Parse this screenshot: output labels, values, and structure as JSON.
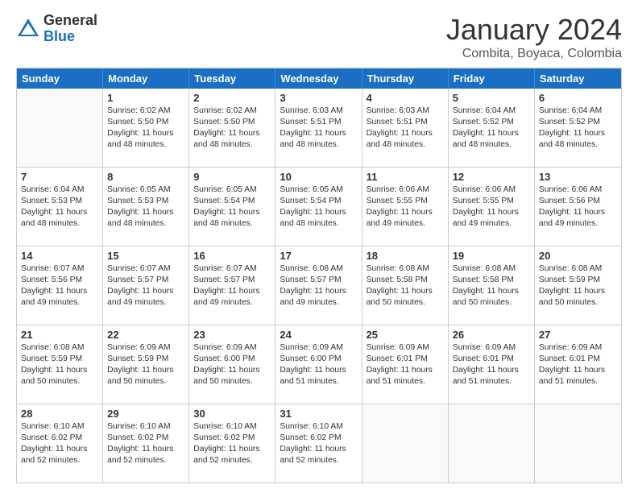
{
  "logo": {
    "general": "General",
    "blue": "Blue"
  },
  "title": "January 2024",
  "subtitle": "Combita, Boyaca, Colombia",
  "days": [
    "Sunday",
    "Monday",
    "Tuesday",
    "Wednesday",
    "Thursday",
    "Friday",
    "Saturday"
  ],
  "weeks": [
    [
      {
        "day": "",
        "empty": true
      },
      {
        "day": "1",
        "lines": [
          "Sunrise: 6:02 AM",
          "Sunset: 5:50 PM",
          "Daylight: 11 hours",
          "and 48 minutes."
        ]
      },
      {
        "day": "2",
        "lines": [
          "Sunrise: 6:02 AM",
          "Sunset: 5:50 PM",
          "Daylight: 11 hours",
          "and 48 minutes."
        ]
      },
      {
        "day": "3",
        "lines": [
          "Sunrise: 6:03 AM",
          "Sunset: 5:51 PM",
          "Daylight: 11 hours",
          "and 48 minutes."
        ]
      },
      {
        "day": "4",
        "lines": [
          "Sunrise: 6:03 AM",
          "Sunset: 5:51 PM",
          "Daylight: 11 hours",
          "and 48 minutes."
        ]
      },
      {
        "day": "5",
        "lines": [
          "Sunrise: 6:04 AM",
          "Sunset: 5:52 PM",
          "Daylight: 11 hours",
          "and 48 minutes."
        ]
      },
      {
        "day": "6",
        "lines": [
          "Sunrise: 6:04 AM",
          "Sunset: 5:52 PM",
          "Daylight: 11 hours",
          "and 48 minutes."
        ]
      }
    ],
    [
      {
        "day": "7",
        "lines": [
          "Sunrise: 6:04 AM",
          "Sunset: 5:53 PM",
          "Daylight: 11 hours",
          "and 48 minutes."
        ]
      },
      {
        "day": "8",
        "lines": [
          "Sunrise: 6:05 AM",
          "Sunset: 5:53 PM",
          "Daylight: 11 hours",
          "and 48 minutes."
        ]
      },
      {
        "day": "9",
        "lines": [
          "Sunrise: 6:05 AM",
          "Sunset: 5:54 PM",
          "Daylight: 11 hours",
          "and 48 minutes."
        ]
      },
      {
        "day": "10",
        "lines": [
          "Sunrise: 6:05 AM",
          "Sunset: 5:54 PM",
          "Daylight: 11 hours",
          "and 48 minutes."
        ]
      },
      {
        "day": "11",
        "lines": [
          "Sunrise: 6:06 AM",
          "Sunset: 5:55 PM",
          "Daylight: 11 hours",
          "and 49 minutes."
        ]
      },
      {
        "day": "12",
        "lines": [
          "Sunrise: 6:06 AM",
          "Sunset: 5:55 PM",
          "Daylight: 11 hours",
          "and 49 minutes."
        ]
      },
      {
        "day": "13",
        "lines": [
          "Sunrise: 6:06 AM",
          "Sunset: 5:56 PM",
          "Daylight: 11 hours",
          "and 49 minutes."
        ]
      }
    ],
    [
      {
        "day": "14",
        "lines": [
          "Sunrise: 6:07 AM",
          "Sunset: 5:56 PM",
          "Daylight: 11 hours",
          "and 49 minutes."
        ]
      },
      {
        "day": "15",
        "lines": [
          "Sunrise: 6:07 AM",
          "Sunset: 5:57 PM",
          "Daylight: 11 hours",
          "and 49 minutes."
        ]
      },
      {
        "day": "16",
        "lines": [
          "Sunrise: 6:07 AM",
          "Sunset: 5:57 PM",
          "Daylight: 11 hours",
          "and 49 minutes."
        ]
      },
      {
        "day": "17",
        "lines": [
          "Sunrise: 6:08 AM",
          "Sunset: 5:57 PM",
          "Daylight: 11 hours",
          "and 49 minutes."
        ]
      },
      {
        "day": "18",
        "lines": [
          "Sunrise: 6:08 AM",
          "Sunset: 5:58 PM",
          "Daylight: 11 hours",
          "and 50 minutes."
        ]
      },
      {
        "day": "19",
        "lines": [
          "Sunrise: 6:08 AM",
          "Sunset: 5:58 PM",
          "Daylight: 11 hours",
          "and 50 minutes."
        ]
      },
      {
        "day": "20",
        "lines": [
          "Sunrise: 6:08 AM",
          "Sunset: 5:59 PM",
          "Daylight: 11 hours",
          "and 50 minutes."
        ]
      }
    ],
    [
      {
        "day": "21",
        "lines": [
          "Sunrise: 6:08 AM",
          "Sunset: 5:59 PM",
          "Daylight: 11 hours",
          "and 50 minutes."
        ]
      },
      {
        "day": "22",
        "lines": [
          "Sunrise: 6:09 AM",
          "Sunset: 5:59 PM",
          "Daylight: 11 hours",
          "and 50 minutes."
        ]
      },
      {
        "day": "23",
        "lines": [
          "Sunrise: 6:09 AM",
          "Sunset: 6:00 PM",
          "Daylight: 11 hours",
          "and 50 minutes."
        ]
      },
      {
        "day": "24",
        "lines": [
          "Sunrise: 6:09 AM",
          "Sunset: 6:00 PM",
          "Daylight: 11 hours",
          "and 51 minutes."
        ]
      },
      {
        "day": "25",
        "lines": [
          "Sunrise: 6:09 AM",
          "Sunset: 6:01 PM",
          "Daylight: 11 hours",
          "and 51 minutes."
        ]
      },
      {
        "day": "26",
        "lines": [
          "Sunrise: 6:09 AM",
          "Sunset: 6:01 PM",
          "Daylight: 11 hours",
          "and 51 minutes."
        ]
      },
      {
        "day": "27",
        "lines": [
          "Sunrise: 6:09 AM",
          "Sunset: 6:01 PM",
          "Daylight: 11 hours",
          "and 51 minutes."
        ]
      }
    ],
    [
      {
        "day": "28",
        "lines": [
          "Sunrise: 6:10 AM",
          "Sunset: 6:02 PM",
          "Daylight: 11 hours",
          "and 52 minutes."
        ]
      },
      {
        "day": "29",
        "lines": [
          "Sunrise: 6:10 AM",
          "Sunset: 6:02 PM",
          "Daylight: 11 hours",
          "and 52 minutes."
        ]
      },
      {
        "day": "30",
        "lines": [
          "Sunrise: 6:10 AM",
          "Sunset: 6:02 PM",
          "Daylight: 11 hours",
          "and 52 minutes."
        ]
      },
      {
        "day": "31",
        "lines": [
          "Sunrise: 6:10 AM",
          "Sunset: 6:02 PM",
          "Daylight: 11 hours",
          "and 52 minutes."
        ]
      },
      {
        "day": "",
        "empty": true
      },
      {
        "day": "",
        "empty": true
      },
      {
        "day": "",
        "empty": true
      }
    ]
  ]
}
